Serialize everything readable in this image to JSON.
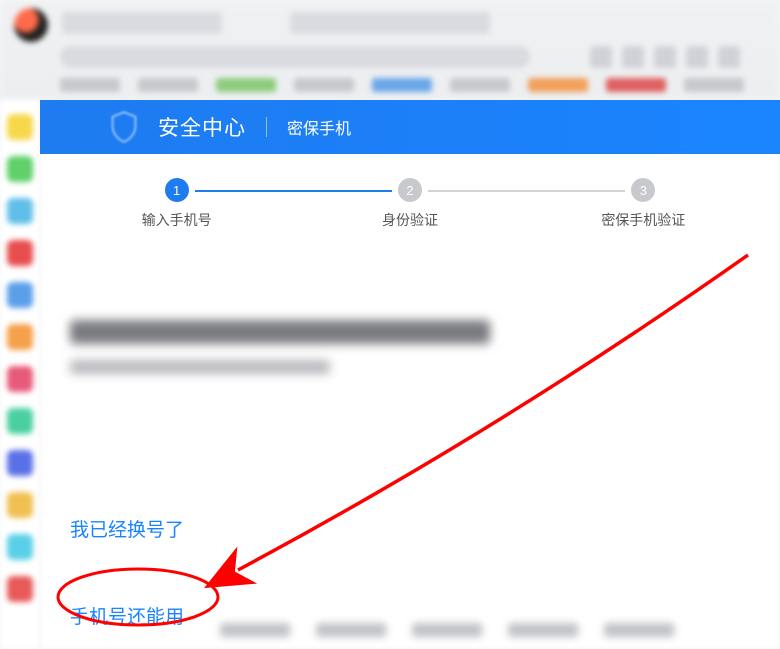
{
  "banner": {
    "title": "安全中心",
    "subtitle": "密保手机"
  },
  "steps": [
    {
      "num": "1",
      "label": "输入手机号"
    },
    {
      "num": "2",
      "label": "身份验证"
    },
    {
      "num": "3",
      "label": "密保手机验证"
    }
  ],
  "options": {
    "changed": "我已经换号了",
    "still_works": "手机号还能用"
  },
  "sidebar_colors": [
    "#f6d84a",
    "#5fd06a",
    "#5fbfe8",
    "#e84d4d",
    "#5a9fe8",
    "#f5a04a",
    "#e85a7a",
    "#4ad0a0",
    "#5a70e8",
    "#f0c050",
    "#5ad0e8",
    "#e85a5a"
  ],
  "annotation": {
    "target": "still_works",
    "shape": "ellipse",
    "arrow": true,
    "color": "#ff0000"
  }
}
